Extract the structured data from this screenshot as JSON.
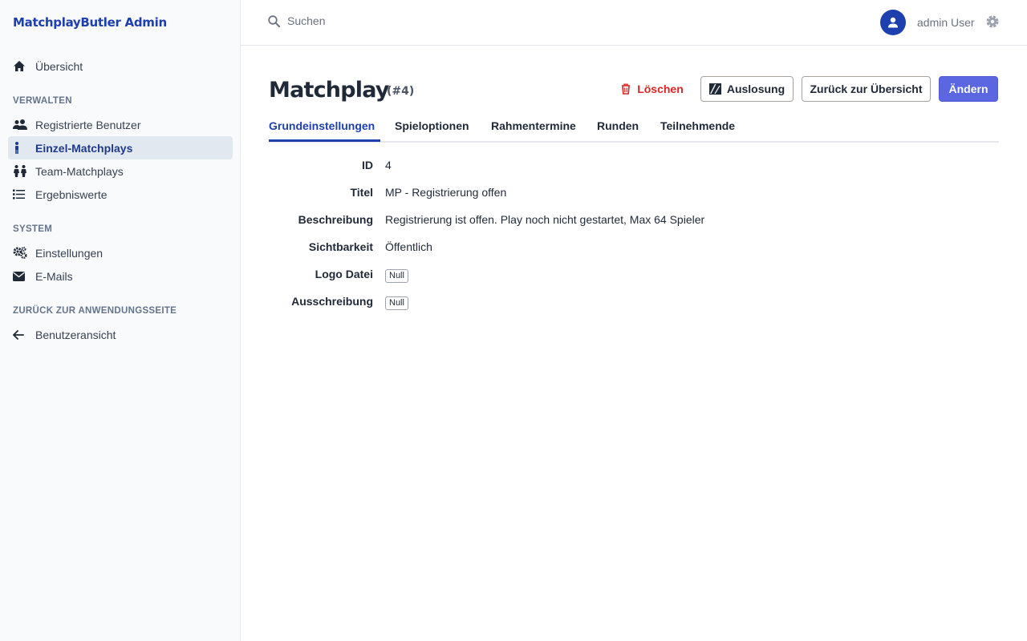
{
  "app": {
    "brand": "MatchplayButler Admin"
  },
  "sidebar": {
    "overview": {
      "label": "Übersicht",
      "icon": "home-icon"
    },
    "sections": {
      "manage": "VERWALTEN",
      "system": "SYSTEM",
      "back": "ZURÜCK ZUR ANWENDUNGSSEITE"
    },
    "manage_items": [
      {
        "label": "Registrierte Benutzer",
        "icon": "users-icon"
      },
      {
        "label": "Einzel-Matchplays",
        "icon": "person-icon",
        "active": true
      },
      {
        "label": "Team-Matchplays",
        "icon": "team-icon"
      },
      {
        "label": "Ergebniswerte",
        "icon": "list-icon"
      }
    ],
    "system_items": [
      {
        "label": "Einstellungen",
        "icon": "cogs-icon"
      },
      {
        "label": "E-Mails",
        "icon": "envelope-icon"
      }
    ],
    "back_items": [
      {
        "label": "Benutzeransicht",
        "icon": "arrow-left-icon"
      }
    ]
  },
  "topbar": {
    "search_placeholder": "Suchen",
    "username": "admin User"
  },
  "page": {
    "title": "Matchplay",
    "id_label": "(#4)",
    "buttons": {
      "delete": "Löschen",
      "draw": "Auslosung",
      "back": "Zurück zur Übersicht",
      "edit": "Ändern"
    },
    "tabs": [
      "Grundeinstellungen",
      "Spieloptionen",
      "Rahmentermine",
      "Runden",
      "Teilnehmende"
    ],
    "active_tab": "Grundeinstellungen",
    "fields": [
      {
        "label": "ID",
        "value": "4"
      },
      {
        "label": "Titel",
        "value": "MP - Registrierung offen"
      },
      {
        "label": "Beschreibung",
        "value": "Registrierung ist offen. Play noch nicht gestartet, Max 64 Spieler"
      },
      {
        "label": "Sichtbarkeit",
        "value": "Öffentlich"
      },
      {
        "label": "Logo Datei",
        "value": "Null",
        "badge": true
      },
      {
        "label": "Ausschreibung",
        "value": "Null",
        "badge": true
      }
    ]
  },
  "colors": {
    "brand": "#1e40af",
    "primary_button": "#5b67e0",
    "danger": "#dc2626",
    "sidebar_bg": "#f8fafc",
    "active_item_bg": "#e2e8f0"
  }
}
